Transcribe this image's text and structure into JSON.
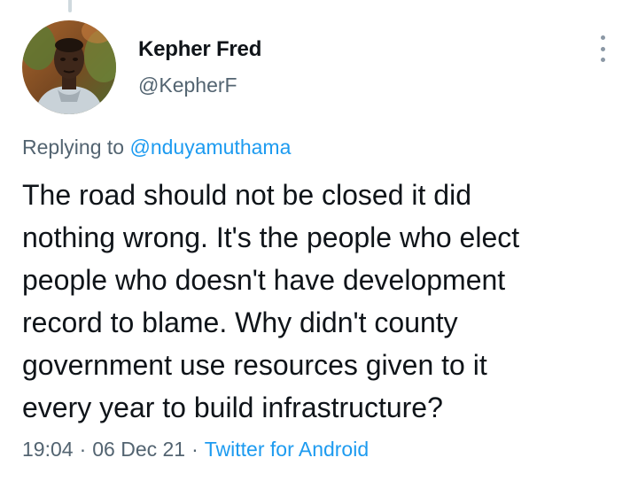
{
  "tweet": {
    "author": {
      "display_name": "Kepher Fred",
      "handle": "@KepherF"
    },
    "replying_to_prefix": "Replying to ",
    "replying_to_handle": "@nduyamuthama",
    "body_lines": [
      "The road should not be closed it did",
      "nothing wrong. It's the people who elect",
      "people who doesn't have development",
      "record to blame. Why didn't county",
      "government use resources given to it",
      "every year to build infrastructure?"
    ],
    "time": "19:04",
    "date": "06 Dec 21",
    "separator": "·",
    "source": "Twitter for Android"
  },
  "icons": {
    "more": "more-vertical-icon",
    "avatar": "avatar-photo"
  },
  "colors": {
    "accent": "#1d9bf0",
    "secondary_text": "#536471",
    "primary_text": "#0f1419"
  }
}
